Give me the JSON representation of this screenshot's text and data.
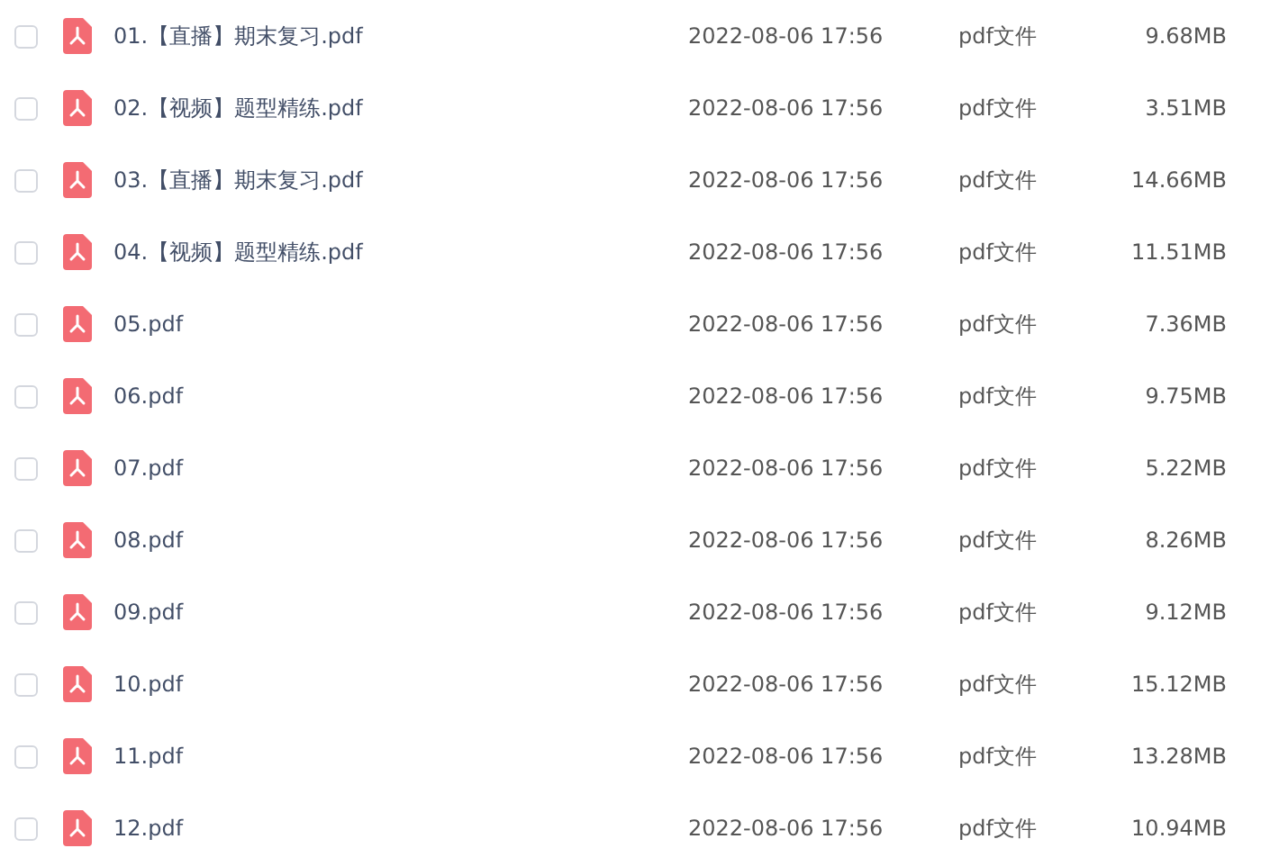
{
  "files": [
    {
      "name": "01.【直播】期末复习.pdf",
      "modified": "2022-08-06 17:56",
      "type": "pdf文件",
      "size": "9.68MB",
      "checked": false
    },
    {
      "name": "02.【视频】题型精练.pdf",
      "modified": "2022-08-06 17:56",
      "type": "pdf文件",
      "size": "3.51MB",
      "checked": false
    },
    {
      "name": "03.【直播】期末复习.pdf",
      "modified": "2022-08-06 17:56",
      "type": "pdf文件",
      "size": "14.66MB",
      "checked": false
    },
    {
      "name": "04.【视频】题型精练.pdf",
      "modified": "2022-08-06 17:56",
      "type": "pdf文件",
      "size": "11.51MB",
      "checked": false
    },
    {
      "name": "05.pdf",
      "modified": "2022-08-06 17:56",
      "type": "pdf文件",
      "size": "7.36MB",
      "checked": false
    },
    {
      "name": "06.pdf",
      "modified": "2022-08-06 17:56",
      "type": "pdf文件",
      "size": "9.75MB",
      "checked": false
    },
    {
      "name": "07.pdf",
      "modified": "2022-08-06 17:56",
      "type": "pdf文件",
      "size": "5.22MB",
      "checked": false
    },
    {
      "name": "08.pdf",
      "modified": "2022-08-06 17:56",
      "type": "pdf文件",
      "size": "8.26MB",
      "checked": false
    },
    {
      "name": "09.pdf",
      "modified": "2022-08-06 17:56",
      "type": "pdf文件",
      "size": "9.12MB",
      "checked": false
    },
    {
      "name": "10.pdf",
      "modified": "2022-08-06 17:56",
      "type": "pdf文件",
      "size": "15.12MB",
      "checked": false
    },
    {
      "name": "11.pdf",
      "modified": "2022-08-06 17:56",
      "type": "pdf文件",
      "size": "13.28MB",
      "checked": false
    },
    {
      "name": "12.pdf",
      "modified": "2022-08-06 17:56",
      "type": "pdf文件",
      "size": "10.94MB",
      "checked": false
    }
  ]
}
